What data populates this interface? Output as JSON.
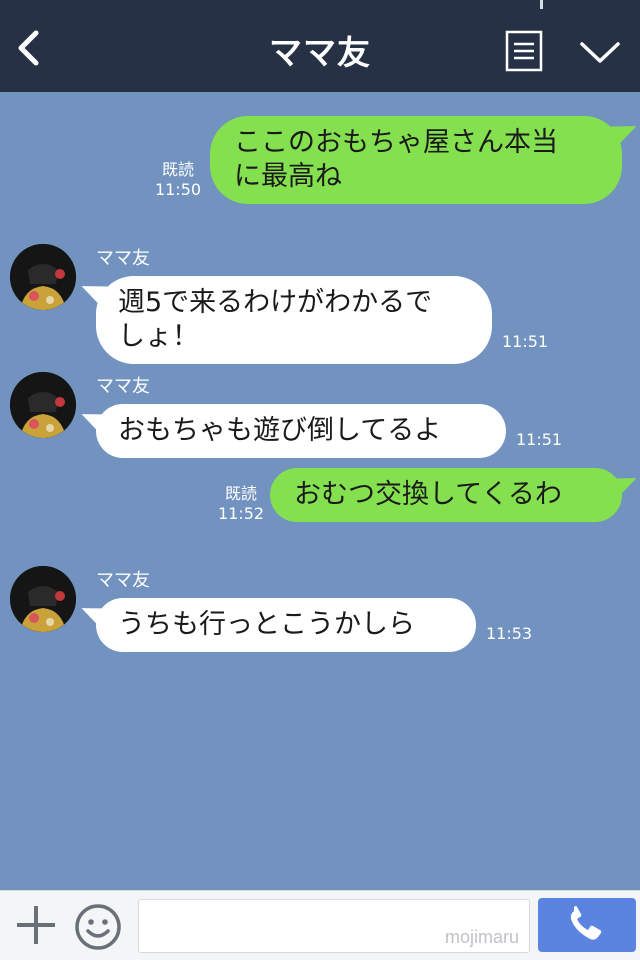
{
  "header": {
    "title": "ママ友",
    "icons": {
      "back": "back-chevron-icon",
      "menu": "menu-list-icon",
      "collapse": "chevron-down-icon"
    }
  },
  "colors": {
    "header_bg": "#273146",
    "chat_bg": "#7293c0",
    "outgoing_bubble": "#84e04f",
    "incoming_bubble": "#ffffff",
    "send_button": "#5b84e0"
  },
  "messages": [
    {
      "direction": "out",
      "text_lines": [
        "ここのおもちゃ屋さん本当",
        "に最高ね"
      ],
      "read_label": "既読",
      "time": "11:50"
    },
    {
      "direction": "in",
      "sender": "ママ友",
      "text_lines": [
        "週5で来るわけがわかるで",
        "しょ！"
      ],
      "time": "11:51"
    },
    {
      "direction": "in",
      "sender": "ママ友",
      "text_lines": [
        "おもちゃも遊び倒してるよ"
      ],
      "time": "11:51"
    },
    {
      "direction": "out",
      "text_lines": [
        "おむつ交換してくるわ"
      ],
      "read_label": "既読",
      "time": "11:52"
    },
    {
      "direction": "in",
      "sender": "ママ友",
      "text_lines": [
        "うちも行っとこうかしら"
      ],
      "time": "11:53"
    }
  ],
  "footer": {
    "input_value": "",
    "watermark": "mojimaru",
    "icons": {
      "plus": "plus-icon",
      "emoji": "smiley-icon",
      "call": "phone-icon"
    }
  }
}
